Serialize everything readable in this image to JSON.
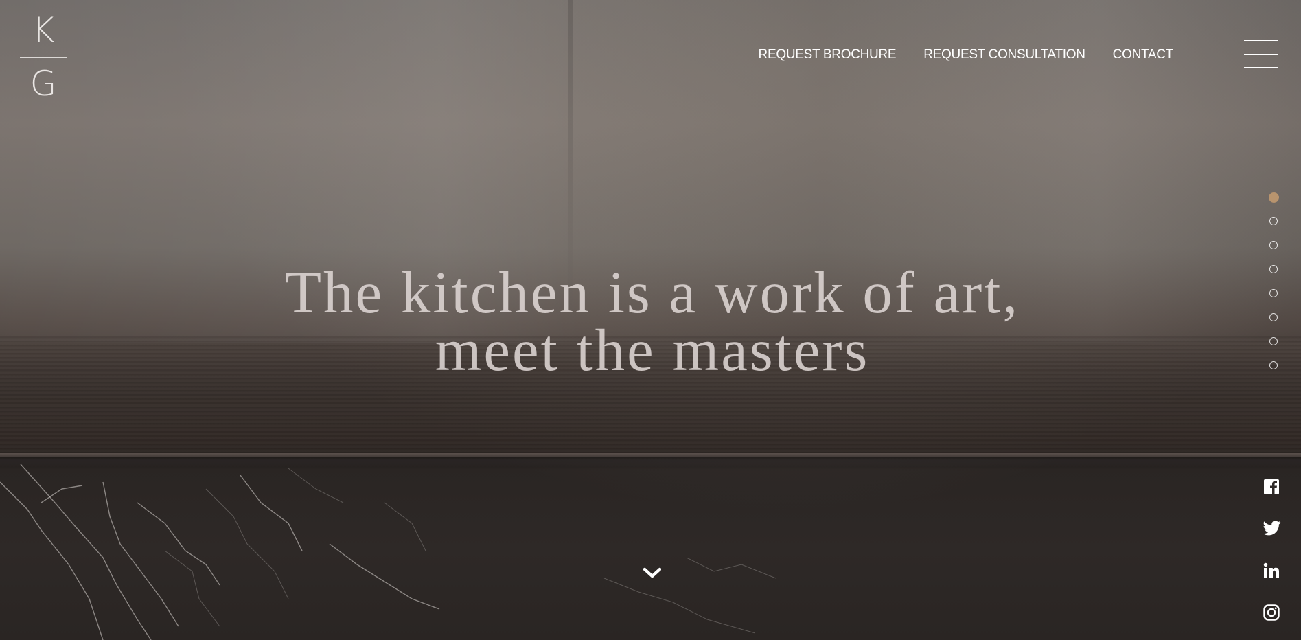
{
  "logo": {
    "top_letter": "K",
    "bottom_letter": "G"
  },
  "nav": {
    "items": [
      {
        "label": "REQUEST BROCHURE"
      },
      {
        "label": "REQUEST CONSULTATION"
      },
      {
        "label": "CONTACT"
      }
    ],
    "menu_icon": "hamburger-icon"
  },
  "hero": {
    "headline_line1": "The kitchen is a work of art,",
    "headline_line2": "meet the masters",
    "scroll_icon": "chevron-down-icon"
  },
  "section_nav": {
    "count": 8,
    "active_index": 0,
    "active_color": "#b8946e"
  },
  "social": {
    "icons": [
      "facebook-icon",
      "twitter-icon",
      "linkedin-icon",
      "instagram-icon"
    ]
  }
}
